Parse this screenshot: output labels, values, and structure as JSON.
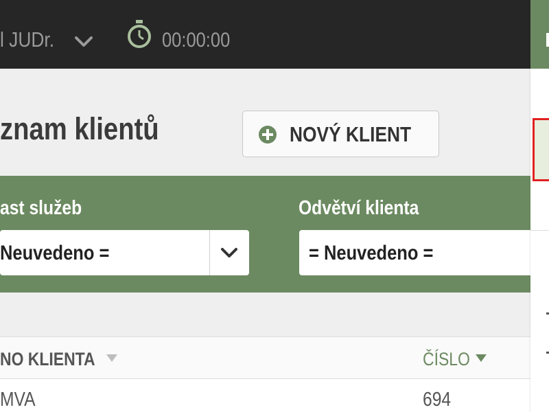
{
  "topbar": {
    "user_label": "l JUDr.",
    "user_menu_icon": "chevron-down-icon",
    "timer_icon": "stopwatch-icon",
    "timer_value": "00:00:00"
  },
  "main": {
    "title": "znam klientů",
    "new_client_button": {
      "icon": "plus-circle-icon",
      "label": "NOVÝ KLIENT"
    }
  },
  "filters": {
    "service_area": {
      "label": "ast služeb",
      "value": "Neuvedeno ="
    },
    "client_industry": {
      "label": "Odvětví klienta",
      "value": "= Neuvedeno ="
    }
  },
  "table": {
    "columns": [
      {
        "label": "NO KLIENTA",
        "sort_icon": "sort-down-icon"
      },
      {
        "label": "ČÍSLO",
        "sort_icon": "sort-down-icon"
      }
    ],
    "rows": [
      {
        "name": "MVA",
        "number": "694"
      }
    ]
  },
  "colors": {
    "topbar": "#262626",
    "accent": "#6c8a61",
    "highlight_border": "#e02020"
  }
}
